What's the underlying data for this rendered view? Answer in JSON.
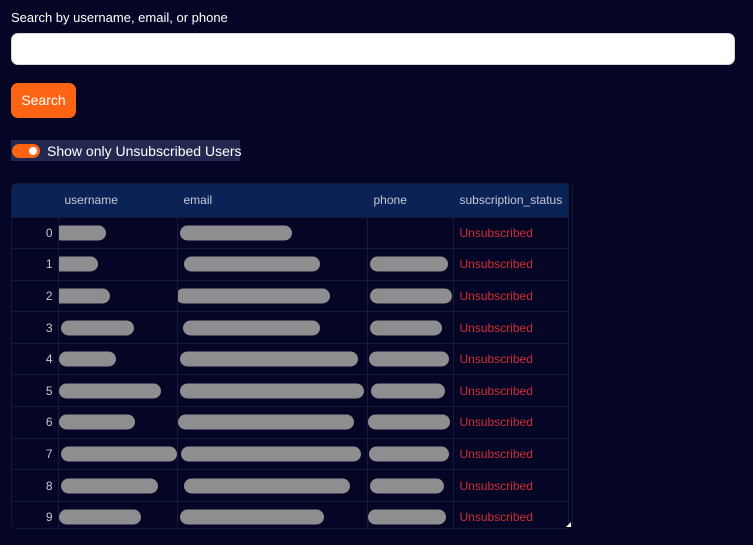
{
  "search": {
    "label": "Search by username, email, or phone",
    "value": "",
    "placeholder": "",
    "button_label": "Search"
  },
  "filter": {
    "toggle_label": "Show only Unsubscribed Users",
    "enabled": true
  },
  "table": {
    "columns": [
      "",
      "username",
      "email",
      "phone",
      "subscription_status"
    ],
    "rows": [
      {
        "index": "0",
        "subscription_status": "Unsubscribed"
      },
      {
        "index": "1",
        "subscription_status": "Unsubscribed"
      },
      {
        "index": "2",
        "subscription_status": "Unsubscribed"
      },
      {
        "index": "3",
        "subscription_status": "Unsubscribed"
      },
      {
        "index": "4",
        "subscription_status": "Unsubscribed"
      },
      {
        "index": "5",
        "subscription_status": "Unsubscribed"
      },
      {
        "index": "6",
        "subscription_status": "Unsubscribed"
      },
      {
        "index": "7",
        "subscription_status": "Unsubscribed"
      },
      {
        "index": "8",
        "subscription_status": "Unsubscribed"
      },
      {
        "index": "9",
        "subscription_status": "Unsubscribed"
      }
    ]
  },
  "colors": {
    "background": "#050625",
    "accent": "#ff6414",
    "table_header": "#0b2257",
    "status_text": "#cf2d36",
    "redaction": "#8e8e90"
  },
  "icons": {
    "table_resize": "resize-handle-icon"
  }
}
